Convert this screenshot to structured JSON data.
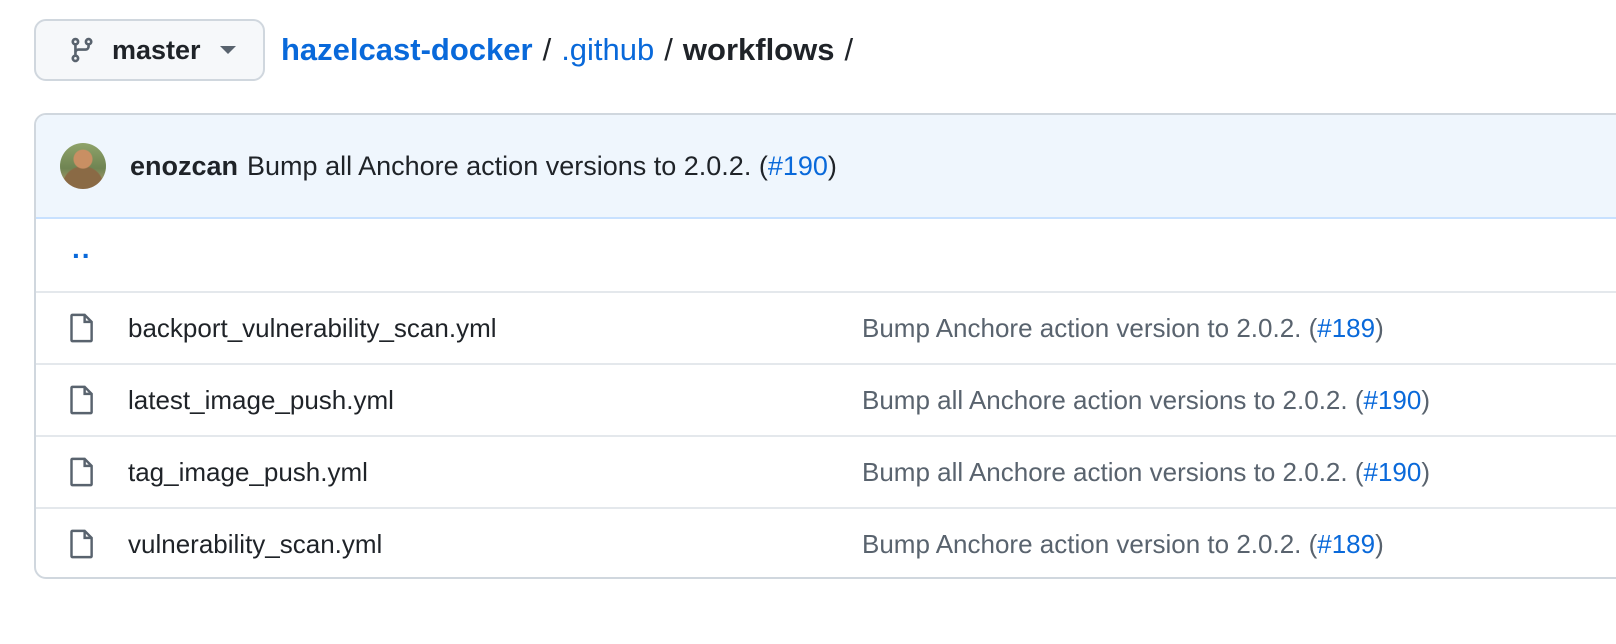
{
  "branch": {
    "name": "master"
  },
  "breadcrumb": {
    "repo": "hazelcast-docker",
    "segments": [
      ".github"
    ],
    "current": "workflows",
    "separator": "/"
  },
  "latest_commit": {
    "author": "enozcan",
    "message": "Bump all Anchore action versions to 2.0.2. (",
    "pr": "#190",
    "close": ")"
  },
  "parent_dir": {
    "label": ".."
  },
  "files": [
    {
      "name": "backport_vulnerability_scan.yml",
      "message": "Bump Anchore action version to 2.0.2. (",
      "pr": "#189",
      "close": ")"
    },
    {
      "name": "latest_image_push.yml",
      "message": "Bump all Anchore action versions to 2.0.2. (",
      "pr": "#190",
      "close": ")"
    },
    {
      "name": "tag_image_push.yml",
      "message": "Bump all Anchore action versions to 2.0.2. (",
      "pr": "#190",
      "close": ")"
    },
    {
      "name": "vulnerability_scan.yml",
      "message": "Bump Anchore action version to 2.0.2. (",
      "pr": "#189",
      "close": ")"
    }
  ],
  "icons": {
    "branch": "git-branch-icon",
    "caret": "caret-down-icon",
    "file": "file-icon",
    "avatar": "avatar"
  },
  "colors": {
    "link": "#0969da",
    "header_bg": "#eff6fd",
    "border": "#d0d7de",
    "muted_text": "#59636e"
  }
}
